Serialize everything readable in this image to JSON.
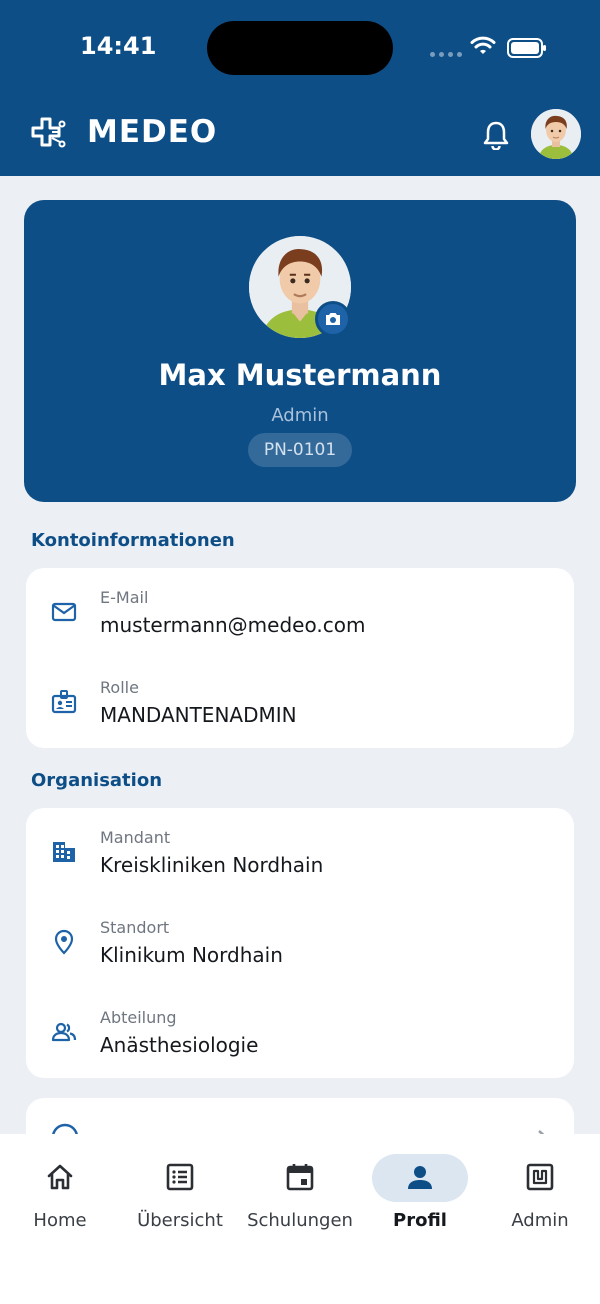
{
  "status_bar": {
    "time": "14:41"
  },
  "header": {
    "title": "MEDEO"
  },
  "profile": {
    "name": "Max Mustermann",
    "role": "Admin",
    "id": "PN-0101"
  },
  "account": {
    "title": "Kontoinformationen",
    "email_label": "E-Mail",
    "email_value": "mustermann@medeo.com",
    "role_label": "Rolle",
    "role_value": "MANDANTENADMIN"
  },
  "organisation": {
    "title": "Organisation",
    "tenant_label": "Mandant",
    "tenant_value": "Kreiskliniken Nordhain",
    "site_label": "Standort",
    "site_value": "Klinikum Nordhain",
    "department_label": "Abteilung",
    "department_value": "Anästhesiologie"
  },
  "nav": {
    "items": [
      {
        "label": "Home",
        "icon": "home-icon"
      },
      {
        "label": "Übersicht",
        "icon": "list-icon"
      },
      {
        "label": "Schulungen",
        "icon": "calendar-icon"
      },
      {
        "label": "Profil",
        "icon": "person-icon",
        "active": true
      },
      {
        "label": "Admin",
        "icon": "admin-icon"
      }
    ]
  },
  "colors": {
    "primary": "#0E4E87",
    "background": "#ECEFF4",
    "active_pill": "#DCE6F1"
  }
}
